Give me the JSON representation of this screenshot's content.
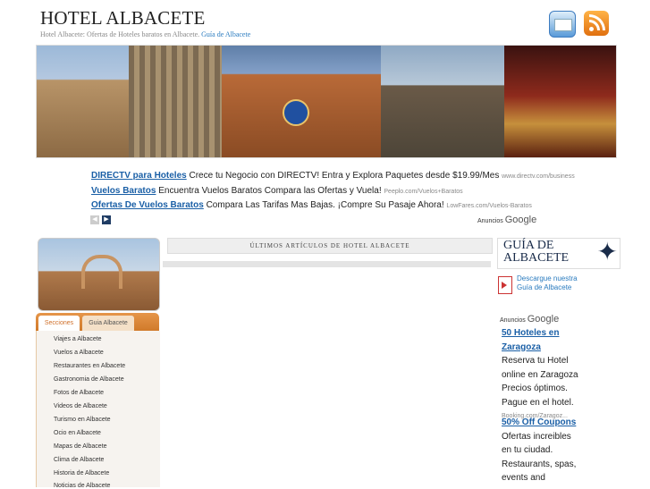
{
  "header": {
    "title": "HOTEL ALBACETE",
    "subtitle_text": "Hotel Albacete: Ofertas de Hoteles baratos en Albacete.",
    "subtitle_link": "Guía de Albacete",
    "mail_icon": "mail-icon",
    "rss_icon": "rss-icon"
  },
  "banner": {
    "photos": [
      "cathedral",
      "arcade",
      "clock-building",
      "villa",
      "theatre"
    ]
  },
  "top_ads": [
    {
      "headline": "DIRECTV para Hoteles",
      "text": "Crece tu Negocio con DIRECTV! Entra y Explora Paquetes desde $19.99/Mes",
      "url": "www.directv.com/business"
    },
    {
      "headline": "Vuelos Baratos",
      "text": "Encuentra Vuelos Baratos Compara las Ofertas y Vuela!",
      "url": "Peeplo.com/Vuelos+Baratos"
    },
    {
      "headline": "Ofertas De Vuelos Baratos",
      "text": "Compara Las Tarifas Mas Bajas. ¡Compre Su Pasaje Ahora!",
      "url": "LowFares.com/Vuelos-Baratos"
    }
  ],
  "ads_label": {
    "prefix": "Anuncios",
    "brand": "Google"
  },
  "sidebar": {
    "tabs": [
      "Secciones",
      "Guia Albacete"
    ],
    "items": [
      "Viajes a Albacete",
      "Vuelos a Albacete",
      "Restaurantes en Albacete",
      "Gastronomia de Albacete",
      "Fotos de Albacete",
      "Videos de Albacete",
      "Turismo en Albacete",
      "Ocio en Albacete",
      "Mapas de Albacete",
      "Clima de Albacete",
      "Historia de Albacete",
      "Noticias de Albacete"
    ]
  },
  "main": {
    "heading": "ÚLTIMOS ARTÍCULOS DE HOTEL ALBACETE"
  },
  "right": {
    "guide_title_line1": "GUÍA DE",
    "guide_title_line2": "ALBACETE",
    "download_line1": "Descargue nuestra",
    "download_line2": "Guía de Albacete",
    "ads": [
      {
        "headline": "50 Hoteles en Zaragoza",
        "text": "Reserva tu Hotel online en Zaragoza Precios óptimos. Pague en el hotel.",
        "url": "Booking.com/Zaragoz..."
      },
      {
        "headline": "50% Off Coupons",
        "text": "Ofertas increibles en tu ciudad. Restaurants, spas, events and"
      }
    ]
  }
}
